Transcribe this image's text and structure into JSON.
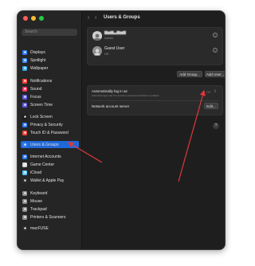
{
  "sidebar": {
    "search_placeholder": "Search",
    "items": [
      {
        "label": "Displays",
        "color": "#2f7cf6"
      },
      {
        "label": "Spotlight",
        "color": "#3d8ef7"
      },
      {
        "label": "Wallpaper",
        "color": "#31a9e8"
      },
      {
        "label": "Notifications",
        "color": "#ff453a"
      },
      {
        "label": "Sound",
        "color": "#ff375f"
      },
      {
        "label": "Focus",
        "color": "#5e5ce6"
      },
      {
        "label": "Screen Time",
        "color": "#5e5ce6"
      },
      {
        "label": "Lock Screen",
        "color": "#1c1c1e"
      },
      {
        "label": "Privacy & Security",
        "color": "#2f7cf6"
      },
      {
        "label": "Touch ID & Password",
        "color": "#ff453a"
      },
      {
        "label": "Users & Groups",
        "color": "#2f7cf6",
        "selected": true
      },
      {
        "label": "Internet Accounts",
        "color": "#2f7cf6"
      },
      {
        "label": "Game Center",
        "color": "#d8d8d8"
      },
      {
        "label": "iCloud",
        "color": "#5ac8fa"
      },
      {
        "label": "Wallet & Apple Pay",
        "color": "#2c2c2e"
      },
      {
        "label": "Keyboard",
        "color": "#8e8e93"
      },
      {
        "label": "Mouse",
        "color": "#8e8e93"
      },
      {
        "label": "Trackpad",
        "color": "#8e8e93"
      },
      {
        "label": "Printers & Scanners",
        "color": "#8e8e93"
      },
      {
        "label": "macFUSE",
        "color": "#2c2c2e"
      }
    ]
  },
  "header": {
    "back": "‹",
    "forward": "›",
    "title": "Users & Groups"
  },
  "users": {
    "admin_subtitle": "Admin",
    "guest_name": "Guest User",
    "guest_status": "Off",
    "add_group_label": "Add Group...",
    "add_user_label": "Add User..."
  },
  "settings": {
    "autologin_label": "Automatically log in as",
    "autologin_note": "Automatic login can't be turned on because FileVault is enabled.",
    "autologin_value": "Off",
    "network_label": "Network account server",
    "edit_label": "Edit..."
  },
  "help_label": "?"
}
